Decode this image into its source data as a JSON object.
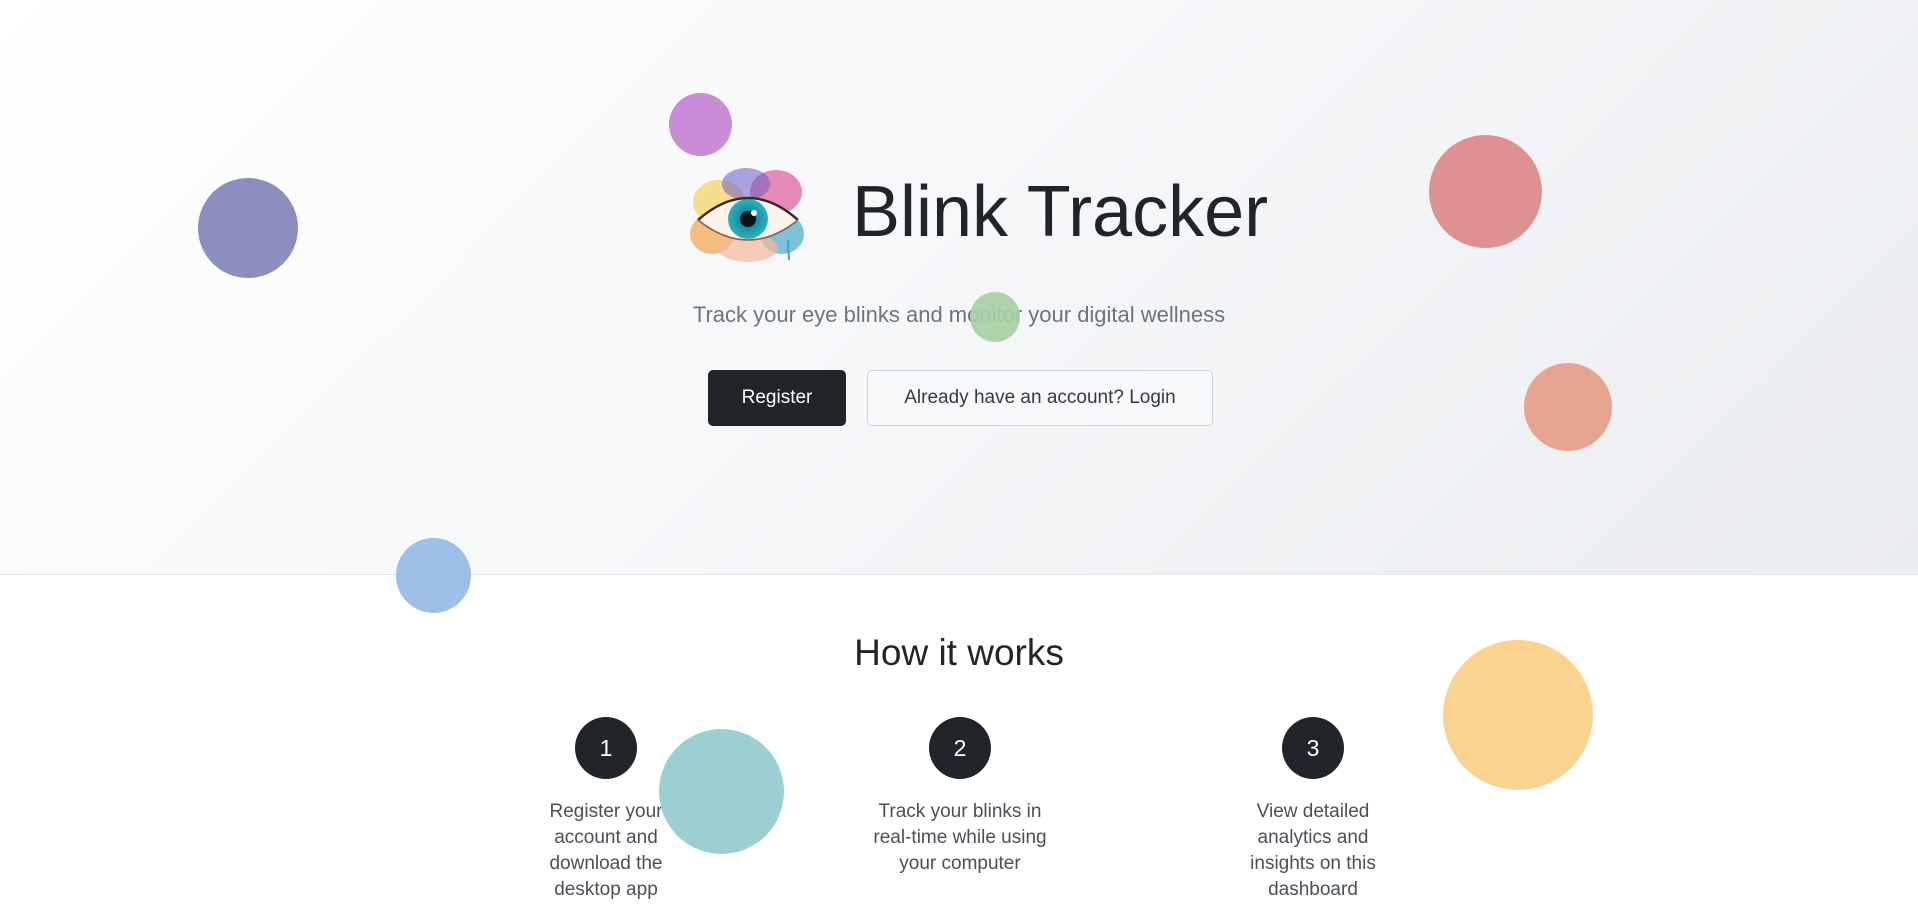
{
  "hero": {
    "title": "Blink Tracker",
    "tagline": "Track your eye blinks and monitor your digital wellness",
    "register_label": "Register",
    "login_label": "Already have an account? Login"
  },
  "how_it_works": {
    "title": "How it works",
    "steps": [
      {
        "number": "1",
        "text": "Register your account and download the desktop app"
      },
      {
        "number": "2",
        "text": "Track your blinks in real-time while using your computer"
      },
      {
        "number": "3",
        "text": "View detailed analytics and insights on this dashboard"
      }
    ]
  },
  "colors": {
    "primary": "#212529",
    "muted_text": "#6c757d",
    "decor_purple": "#c37fd1",
    "decor_indigo": "#8b8fbf",
    "decor_red": "#df9192",
    "decor_green": "#a6cfa4",
    "decor_salmon": "#e6a491",
    "decor_blue": "#9dc0e8",
    "decor_teal": "#9bcfd2",
    "decor_orange": "#fcd290"
  }
}
